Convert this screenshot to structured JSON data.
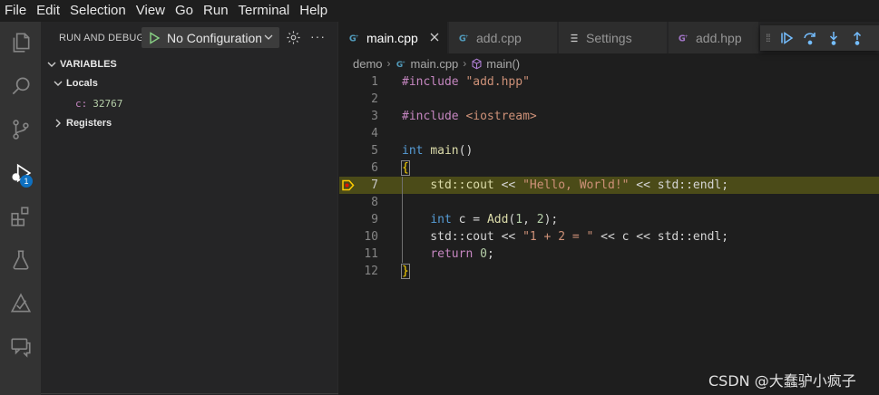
{
  "menubar": [
    "File",
    "Edit",
    "Selection",
    "View",
    "Go",
    "Run",
    "Terminal",
    "Help"
  ],
  "activity_bar": {
    "items": [
      "explorer-icon",
      "search-icon",
      "source-control-icon",
      "run-debug-icon",
      "extensions-icon",
      "testing-icon",
      "remote-icon",
      "comments-icon"
    ],
    "debug_badge": "1"
  },
  "sidebar": {
    "title": "RUN AND DEBUG",
    "configuration": "No Configuration",
    "more": "···",
    "variables_label": "VARIABLES",
    "locals_label": "Locals",
    "variable": {
      "name": "c:",
      "value": "32767"
    },
    "registers_label": "Registers"
  },
  "tabs": [
    {
      "name": "main.cpp",
      "icon": "cpp-icon",
      "active": true
    },
    {
      "name": "add.cpp",
      "icon": "cpp-icon",
      "active": false
    },
    {
      "name": "Settings",
      "icon": "settings-icon",
      "active": false
    },
    {
      "name": "add.hpp",
      "icon": "cpp-header-icon",
      "active": false
    }
  ],
  "breadcrumb": {
    "folder": "demo",
    "file": "main.cpp",
    "symbol": "main()"
  },
  "code": {
    "line_numbers": [
      "1",
      "2",
      "3",
      "4",
      "5",
      "6",
      "7",
      "8",
      "9",
      "10",
      "11",
      "12"
    ],
    "current_line": 7
  },
  "colors": {
    "accent": "#0e70c0",
    "current_line_bg": "#4b4b18",
    "breakpoint": "#ffcc00"
  },
  "watermark": "CSDN @大蠢驴小疯子"
}
